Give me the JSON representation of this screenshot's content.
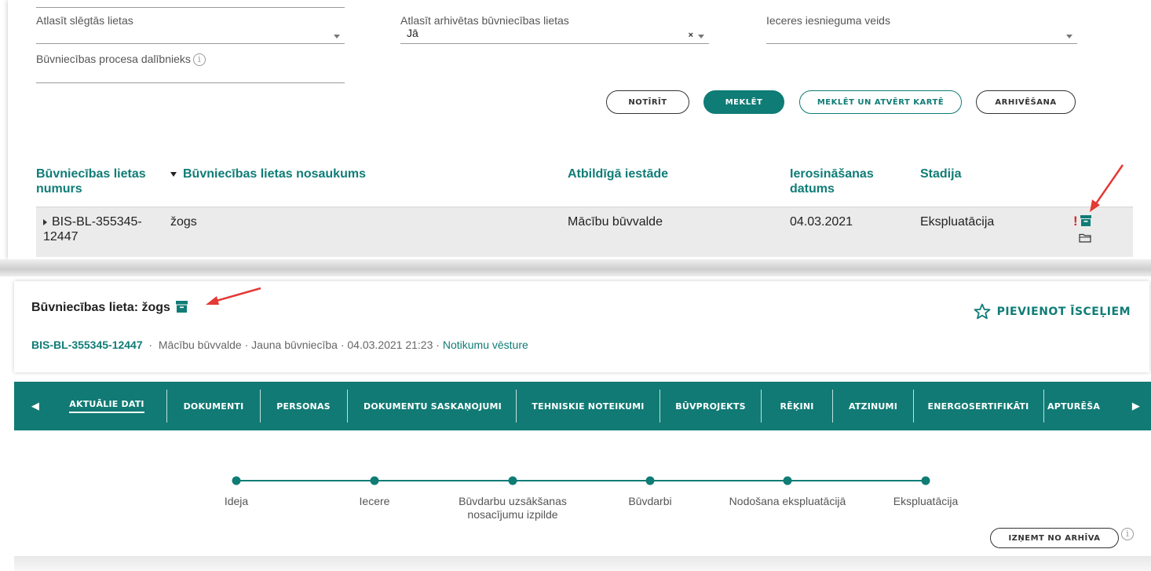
{
  "filters": {
    "closed_cases": {
      "label": "Atlasīt slēgtās lietas",
      "value": ""
    },
    "archived_cases": {
      "label": "Atlasīt arhivētas būvniecības lietas",
      "value": "Jā",
      "clear": "×"
    },
    "submission_type": {
      "label": "Ieceres iesnieguma veids",
      "value": ""
    },
    "participant": {
      "label": "Būvniecības procesa dalībnieks",
      "value": ""
    },
    "info_glyph": "i"
  },
  "buttons": {
    "clear": "NOTĪRĪT",
    "search": "MEKLĒT",
    "search_map": "MEKLĒT UN ATVĒRT KARTĒ",
    "archiving": "ARHIVĒŠANA"
  },
  "table": {
    "headers": {
      "number": "Būvniecības lietas numurs",
      "name": "Būvniecības lietas nosaukums",
      "authority": "Atbildīgā iestāde",
      "date": "Ierosināšanas datums",
      "stage": "Stadija"
    },
    "rows": [
      {
        "number": "BIS-BL-355345-12447",
        "name": "žogs",
        "authority": "Mācību būvvalde",
        "date": "04.03.2021",
        "stage": "Ekspluatācija",
        "warning": "!"
      }
    ]
  },
  "case": {
    "title": "Būvniecības lieta: žogs",
    "number": "BIS-BL-355345-12447",
    "sep": "·",
    "authority": "Mācību būvvalde",
    "type": "Jauna būvniecība",
    "datetime": "04.03.2021 21:23",
    "history_link": "Notikumu vēsture",
    "favorite": "PIEVIENOT ĪSCEĻIEM"
  },
  "tabs": [
    "AKTUĀLIE DATI",
    "DOKUMENTI",
    "PERSONAS",
    "DOKUMENTU SASKAŅOJUMI",
    "TEHNISKIE NOTEIKUMI",
    "BŪVPROJEKTS",
    "RĒĶINI",
    "ATZINUMI",
    "ENERGOSERTIFIKĀTI",
    "APTURĒŠA"
  ],
  "stages": [
    {
      "label": "Ideja"
    },
    {
      "label": "Iecere"
    },
    {
      "label": "Būvdarbu uzsākšanas",
      "label2": "nosacījumu izpilde"
    },
    {
      "label": "Būvdarbi"
    },
    {
      "label": "Nodošana ekspluatācijā"
    },
    {
      "label": "Ekspluatācija"
    }
  ],
  "unarchive_button": "IZŅEMT NO ARHĪVA",
  "colors": {
    "accent": "#0f7c76",
    "warning": "#d9262c",
    "arrow": "#e53935"
  },
  "icons": [
    "archive-box-icon",
    "folder-icon",
    "star-outline-icon",
    "info-icon",
    "chevron-left-icon",
    "chevron-right-icon"
  ]
}
